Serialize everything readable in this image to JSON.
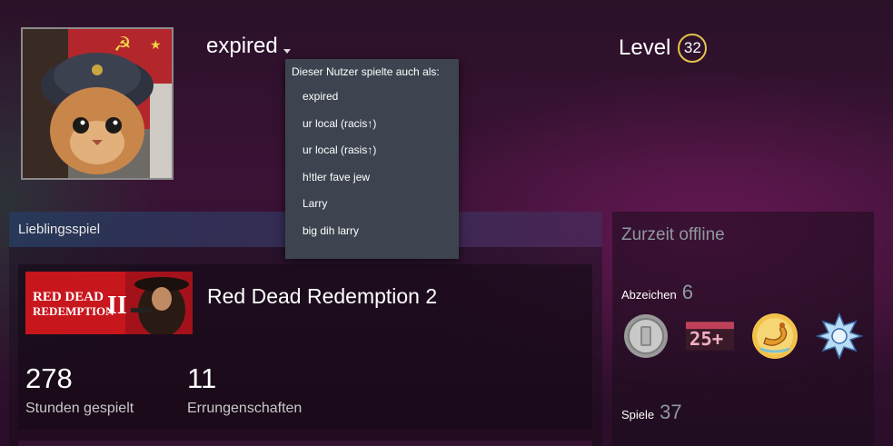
{
  "profile": {
    "persona_name": "expired",
    "level_label": "Level",
    "level_value": "32"
  },
  "alias_dropdown": {
    "title": "Dieser Nutzer spielte auch als:",
    "items": [
      "expired",
      "ur local (racis↑)",
      "ur local (rasis↑)",
      "h!tler fave jew",
      "Larry",
      "big dih larry"
    ]
  },
  "favorite_game": {
    "header": "Lieblingsspiel",
    "game_name": "Red Dead Redemption 2",
    "capsule_text_line1": "RED DEAD",
    "capsule_text_line2": "REDEMPTION",
    "capsule_numeral": "II",
    "hours_value": "278",
    "hours_label": "Stunden gespielt",
    "achievements_value": "11",
    "achievements_label": "Errungenschaften"
  },
  "side": {
    "status": "Zurzeit offline",
    "badges_label": "Abzeichen",
    "badges_count": "6",
    "games_label": "Spiele",
    "games_count": "37",
    "badge_25_text": "25+",
    "badge_icons": [
      "silver-coin-badge-icon",
      "years-of-service-badge-icon",
      "scorpion-badge-icon",
      "snowflake-badge-icon"
    ]
  },
  "colors": {
    "level_ring": "#e6c34a",
    "dropdown_bg": "#3d4450",
    "muted_text": "#8f98a0"
  }
}
